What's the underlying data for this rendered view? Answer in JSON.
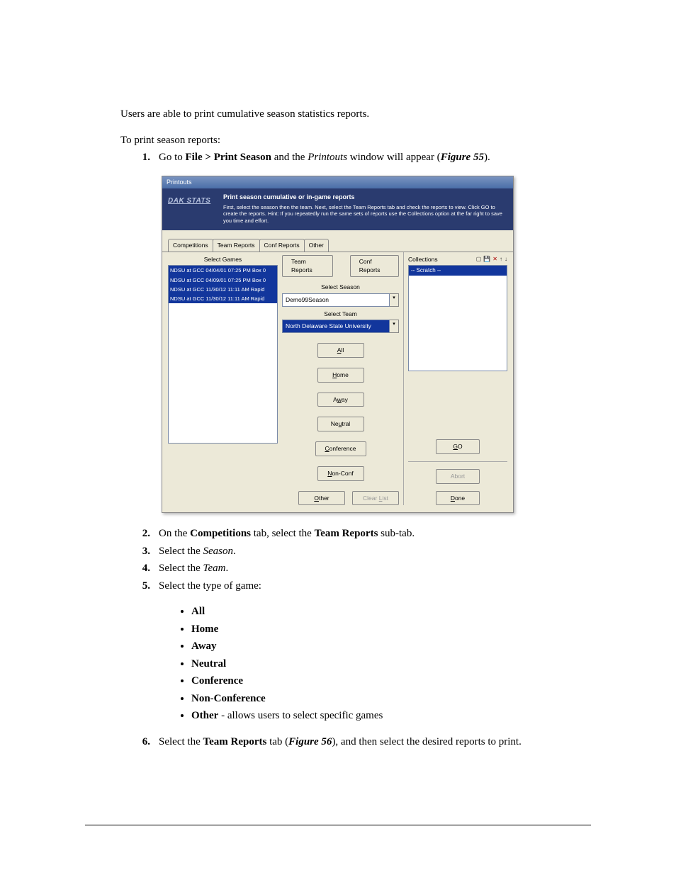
{
  "intro_text": "Users are able to print cumulative season statistics reports.",
  "lead_in": "To print season reports:",
  "step1": {
    "num": "1.",
    "a": "Go to ",
    "b": "File > Print Season",
    "c": " and the ",
    "d": "Printouts",
    "e": " window will appear (",
    "f": "Figure 55",
    "g": ")."
  },
  "win": {
    "title": "Printouts",
    "logo": "DAK STATS",
    "header_title": "Print season cumulative or in-game reports",
    "header_body": "First, select the season then the team. Next, select the Team Reports tab and check the reports to view. Click GO to create the reports. Hint: If you repeatedly run the same sets of reports use the Collections option at the far right to save you time and effort.",
    "tabs": {
      "t1": "Competitions",
      "t2": "Team Reports",
      "t3": "Conf Reports",
      "t4": "Other"
    },
    "select_games_label": "Select Games",
    "games": [
      "NDSU at GCC 04/04/01 07:25 PM  Box 0",
      "NDSU at GCC 04/09/01 07:25 PM  Box 0",
      "NDSU at GCC 11/30/12 11:11 AM  Rapid",
      "NDSU at GCC 11/30/12 11:11 AM  Rapid"
    ],
    "subtabs": {
      "team": "Team Reports",
      "conf": "Conf Reports"
    },
    "select_season_label": "Select Season",
    "season_value": "Demo99Season",
    "select_team_label": "Select Team",
    "team_value": "North Delaware State University",
    "buttons": {
      "all": "All",
      "home": "Home",
      "away": "Away",
      "neutral": "Neutral",
      "conference": "Conference",
      "nonconf": "Non-Conf",
      "other": "Other",
      "clear": "Clear List"
    },
    "collections_label": "Collections",
    "scratch": "-- Scratch --",
    "go": "GO",
    "abort": "Abort",
    "done": "Done"
  },
  "step2": {
    "num": "2.",
    "a": "On the ",
    "b": "Competitions",
    "c": " tab, select the ",
    "d": "Team Reports",
    "e": " sub-tab."
  },
  "step3": {
    "num": "3.",
    "a": "Select the ",
    "b": "Season",
    "c": "."
  },
  "step4": {
    "num": "4.",
    "a": "Select the ",
    "b": "Team",
    "c": "."
  },
  "step5": {
    "num": "5.",
    "a": "Select the type of game:"
  },
  "bullets": {
    "b1": "All",
    "b2": "Home",
    "b3": "Away",
    "b4": "Neutral",
    "b5": "Conference",
    "b6": "Non-Conference",
    "b7a": "Other",
    "b7b": " - allows users to select specific games"
  },
  "step6": {
    "num": "6.",
    "a": "Select the ",
    "b": "Team Reports",
    "c": " tab (",
    "d": "Figure 56",
    "e": "), and then select the desired reports to print."
  }
}
